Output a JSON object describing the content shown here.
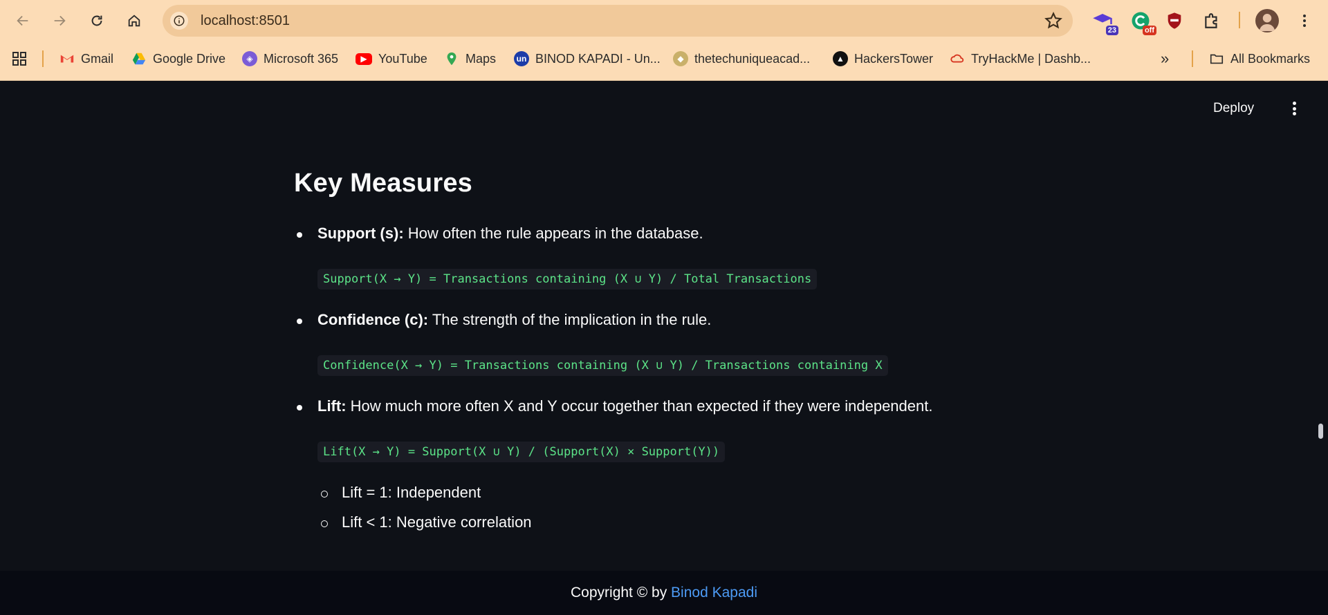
{
  "browser": {
    "url": "localhost:8501",
    "extensions": [
      {
        "icon": "graduation-cap-icon",
        "badge": "23",
        "color": "#5a3bd6"
      },
      {
        "icon": "grammarly-icon",
        "badge": "off",
        "color": "#15a36b"
      },
      {
        "icon": "shield-icon",
        "badge": "",
        "color": "#a3141b"
      },
      {
        "icon": "puzzle-icon",
        "badge": "",
        "color": "#333333"
      }
    ],
    "bookmarks": [
      {
        "label": "Gmail",
        "icon": "gmail-icon"
      },
      {
        "label": "Google Drive",
        "icon": "google-drive-icon"
      },
      {
        "label": "Microsoft 365",
        "icon": "microsoft-365-icon"
      },
      {
        "label": "YouTube",
        "icon": "youtube-icon"
      },
      {
        "label": "Maps",
        "icon": "maps-icon"
      },
      {
        "label": "BINOD KAPADI - Un...",
        "icon": "unstop-icon"
      },
      {
        "label": "thetechuniqueacad...",
        "icon": "academy-icon"
      },
      {
        "label": "HackersTower",
        "icon": "hackerstower-icon"
      },
      {
        "label": "TryHackMe | Dashb...",
        "icon": "tryhackme-icon"
      }
    ],
    "all_bookmarks": "All Bookmarks"
  },
  "app": {
    "deploy_label": "Deploy",
    "heading": "Key Measures",
    "measures": [
      {
        "term": "Support (s):",
        "description": " How often the rule appears in the database.",
        "formula": "Support(X → Y) = Transactions containing (X ∪ Y) / Total Transactions"
      },
      {
        "term": "Confidence (c):",
        "description": " The strength of the implication in the rule.",
        "formula": "Confidence(X → Y) = Transactions containing (X ∪ Y) / Transactions containing X"
      },
      {
        "term": "Lift:",
        "description": " How much more often X and Y occur together than expected if they were independent.",
        "formula": "Lift(X → Y) = Support(X ∪ Y) / (Support(X) × Support(Y))"
      }
    ],
    "lift_notes": [
      "Lift = 1: Independent",
      "Lift < 1: Negative correlation"
    ]
  },
  "footer": {
    "prefix": "Copyright © by ",
    "author": "Binod Kapadi"
  }
}
